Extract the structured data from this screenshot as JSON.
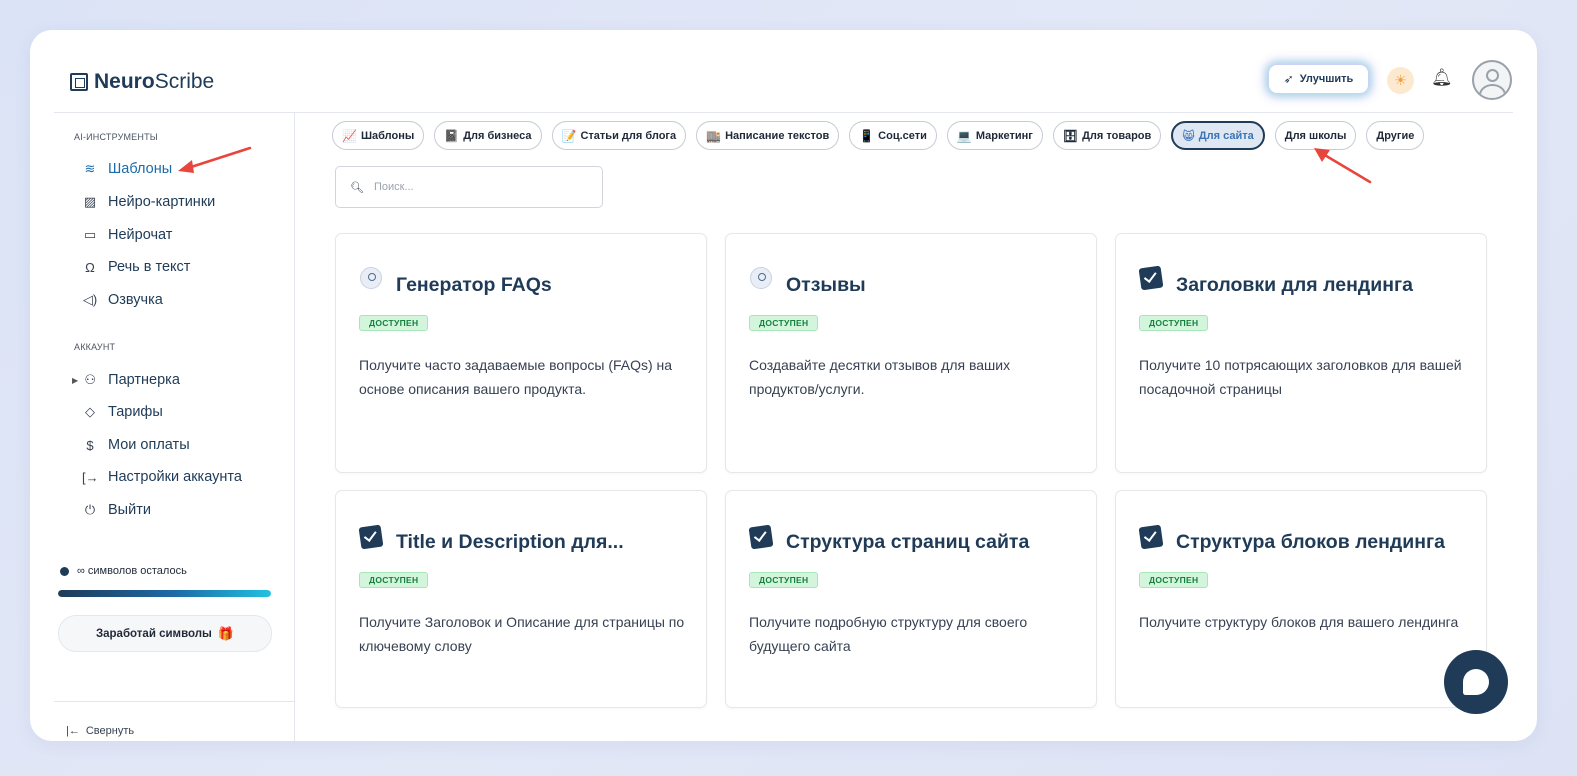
{
  "brand": {
    "bold": "Neuro",
    "light": "Scribe"
  },
  "header": {
    "upgrade_label": "Улучшить"
  },
  "sidebar": {
    "ai_section": "AI-ИНСТРУМЕНТЫ",
    "ai_items": [
      {
        "label": "Шаблоны",
        "icon": "layers-icon"
      },
      {
        "label": "Нейро-картинки",
        "icon": "image-icon"
      },
      {
        "label": "Нейрочат",
        "icon": "chat-icon"
      },
      {
        "label": "Речь в текст",
        "icon": "headphones-icon"
      },
      {
        "label": "Озвучка",
        "icon": "speaker-icon"
      }
    ],
    "account_section": "АККАУНТ",
    "account_items": [
      {
        "label": "Партнерка",
        "icon": "users-icon"
      },
      {
        "label": "Тарифы",
        "icon": "tag-icon"
      },
      {
        "label": "Мои оплаты",
        "icon": "dollar-icon"
      },
      {
        "label": "Настройки аккаунта",
        "icon": "logout-icon"
      },
      {
        "label": "Выйти",
        "icon": "power-icon"
      }
    ],
    "symbols_left": "∞ символов осталось",
    "symbols_progress": 1.0,
    "earn_label": "Заработай символы",
    "collapse_label": "Свернуть"
  },
  "chips": [
    {
      "emoji": "📈",
      "label": "Шаблоны"
    },
    {
      "emoji": "📓",
      "label": "Для бизнеса"
    },
    {
      "emoji": "📝",
      "label": "Статьи для блога"
    },
    {
      "emoji": "🏬",
      "label": "Написание текстов"
    },
    {
      "emoji": "📱",
      "label": "Соц.сети"
    },
    {
      "emoji": "💻",
      "label": "Маркетинг"
    },
    {
      "emoji": "🗄",
      "label": "Для товаров"
    },
    {
      "emoji": "😸",
      "label": "Для сайта"
    },
    {
      "emoji": "",
      "label": "Для школы"
    },
    {
      "emoji": "",
      "label": "Другие"
    }
  ],
  "search": {
    "placeholder": "Поиск..."
  },
  "cards": [
    {
      "title": "Генератор FAQs",
      "badge": "ДОСТУПЕН",
      "desc": "Получите часто задаваемые вопросы (FAQs) на основе описания вашего продукта."
    },
    {
      "title": "Отзывы",
      "badge": "ДОСТУПЕН",
      "desc": "Создавайте десятки отзывов для ваших продуктов/услуги."
    },
    {
      "title": "Заголовки для лендинга",
      "badge": "ДОСТУПЕН",
      "desc": "Получите 10 потрясающих заголовков для вашей посадочной страницы"
    },
    {
      "title": "Title и Description для...",
      "badge": "ДОСТУПЕН",
      "desc": "Получите Заголовок и Описание для страницы по ключевому слову"
    },
    {
      "title": "Структура страниц сайта",
      "badge": "ДОСТУПЕН",
      "desc": "Получите подробную структуру для своего будущего сайта"
    },
    {
      "title": "Структура блоков лендинга",
      "badge": "ДОСТУПЕН",
      "desc": "Получите структуру блоков для вашего лендинга"
    }
  ],
  "colors": {
    "primary": "#1f3b57",
    "active": "#1b6ca8",
    "badge_bg": "#d3f5dc",
    "arrow": "#e8453c"
  }
}
